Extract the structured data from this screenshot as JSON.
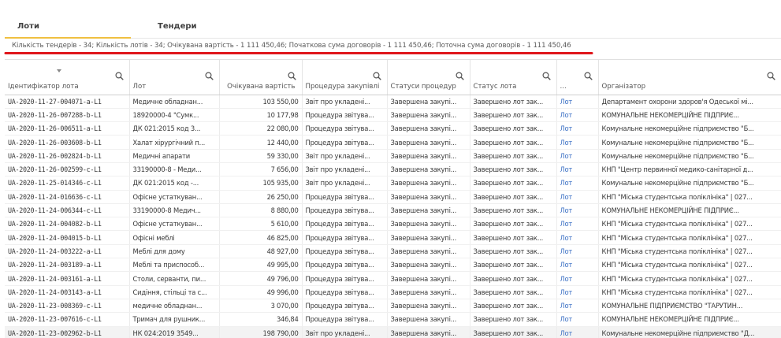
{
  "tabs": [
    {
      "label": "Лоти",
      "active": true
    },
    {
      "label": "Тендери",
      "active": false
    }
  ],
  "summary": "Кількість тендерів - 34; Кількість лотів - 34; Очікувана вартість - 1 111 450,46; Початкова сума договорів - 1 111 450,46; Поточна сума договорів - 1 111 450,46",
  "colors": {
    "accent_tab": "#f0c040",
    "underline": "#e0161b",
    "link": "#3a6fc4"
  },
  "columns": [
    {
      "label": "Ідентифікатор лота"
    },
    {
      "label": "Лот"
    },
    {
      "label": "Очікувана вартість"
    },
    {
      "label": "Процедура закупівлі"
    },
    {
      "label": "Статуси процедур"
    },
    {
      "label": "Статус лота"
    },
    {
      "label": "..."
    },
    {
      "label": "Організатор"
    }
  ],
  "rows": [
    [
      "UA-2020-11-27-004071-a-L1",
      "Медичне обладнан...",
      "103 550,00",
      "Звіт про укладені...",
      "Завершена закупі...",
      "Завершено лот зак...",
      "Лот",
      "Департамент охорони здоров'я Одеської мі..."
    ],
    [
      "UA-2020-11-26-007288-b-L1",
      "18920000-4 \"Сумк...",
      "10 177,98",
      "Процедура звітува...",
      "Завершена закупі...",
      "Завершено лот зак...",
      "Лот",
      "КОМУНАЛЬНЕ НЕКОМЕРЦІЙНЕ ПІДПРИЄ..."
    ],
    [
      "UA-2020-11-26-006511-a-L1",
      "ДК 021:2015 код 3...",
      "22 080,00",
      "Процедура звітува...",
      "Завершена закупі...",
      "Завершено лот зак...",
      "Лот",
      "Комунальне некомерційне підприємство \"Б..."
    ],
    [
      "UA-2020-11-26-003608-b-L1",
      "Халат хірургічний п...",
      "12 440,00",
      "Процедура звітува...",
      "Завершена закупі...",
      "Завершено лот зак...",
      "Лот",
      "Комунальне некомерційне підприємство \"Б..."
    ],
    [
      "UA-2020-11-26-002824-b-L1",
      "Медичні апарати",
      "59 330,00",
      "Звіт про укладені...",
      "Завершена закупі...",
      "Завершено лот зак...",
      "Лот",
      "Комунальне некомерційне підприємство \"Б..."
    ],
    [
      "UA-2020-11-26-002599-c-L1",
      "33190000-8 - Меди...",
      "7 656,00",
      "Звіт про укладені...",
      "Завершена закупі...",
      "Завершено лот зак...",
      "Лот",
      "КНП \"Центр первинної медико-санітарної д..."
    ],
    [
      "UA-2020-11-25-014346-c-L1",
      "ДК 021:2015 код -...",
      "105 935,00",
      "Звіт про укладені...",
      "Завершена закупі...",
      "Завершено лот зак...",
      "Лот",
      "Комунальне некомерційне підприємство \"Б..."
    ],
    [
      "UA-2020-11-24-016636-c-L1",
      "Офісне устаткуван...",
      "26 250,00",
      "Процедура звітува...",
      "Завершена закупі...",
      "Завершено лот зак...",
      "Лот",
      "КНП \"Міська студентська поліклініка\" | 027..."
    ],
    [
      "UA-2020-11-24-006344-c-L1",
      "33190000-8 Медич...",
      "8 880,00",
      "Процедура звітува...",
      "Завершена закупі...",
      "Завершено лот зак...",
      "Лот",
      "КОМУНАЛЬНЕ НЕКОМЕРЦІЙНЕ ПІДПРИЄ..."
    ],
    [
      "UA-2020-11-24-004082-b-L1",
      "Офісне устаткуван...",
      "5 610,00",
      "Процедура звітува...",
      "Завершена закупі...",
      "Завершено лот зак...",
      "Лот",
      "КНП \"Міська студентська поліклініка\" | 027..."
    ],
    [
      "UA-2020-11-24-004015-b-L1",
      "Офісні меблі",
      "46 825,00",
      "Процедура звітува...",
      "Завершена закупі...",
      "Завершено лот зак...",
      "Лот",
      "КНП \"Міська студентська поліклініка\" | 027..."
    ],
    [
      "UA-2020-11-24-003222-a-L1",
      "Меблі для дому",
      "48 927,00",
      "Процедура звітува...",
      "Завершена закупі...",
      "Завершено лот зак...",
      "Лот",
      "КНП \"Міська студентська поліклініка\" | 027..."
    ],
    [
      "UA-2020-11-24-003189-a-L1",
      "Меблі та приспособ...",
      "49 995,00",
      "Процедура звітува...",
      "Завершена закупі...",
      "Завершено лот зак...",
      "Лот",
      "КНП \"Міська студентська поліклініка\" | 027..."
    ],
    [
      "UA-2020-11-24-003161-a-L1",
      "Столи, серванти, пи...",
      "49 796,00",
      "Процедура звітува...",
      "Завершена закупі...",
      "Завершено лот зак...",
      "Лот",
      "КНП \"Міська студентська поліклініка\" | 027..."
    ],
    [
      "UA-2020-11-24-003143-a-L1",
      "Сидіння, стільці та с...",
      "49 996,00",
      "Процедура звітува...",
      "Завершена закупі...",
      "Завершено лот зак...",
      "Лот",
      "КНП \"Міська студентська поліклініка\" | 027..."
    ],
    [
      "UA-2020-11-23-008369-c-L1",
      "медичне обладнан...",
      "3 070,00",
      "Процедура звітува...",
      "Завершена закупі...",
      "Завершено лот зак...",
      "Лот",
      "КОМУНАЛЬНЕ ПІДПРИЄМСТВО \"ТАРУТИН..."
    ],
    [
      "UA-2020-11-23-007616-c-L1",
      "Тримач для рушник...",
      "346,84",
      "Процедура звітува...",
      "Завершена закупі...",
      "Завершено лот зак...",
      "Лот",
      "КОМУНАЛЬНЕ НЕКОМЕРЦІЙНЕ ПІДПРИЄ..."
    ],
    [
      "UA-2020-11-23-002962-b-L1",
      "НК 024:2019 3549...",
      "198 790,00",
      "Звіт про укладені...",
      "Завершена закупі...",
      "Завершено лот зак...",
      "Лот",
      "Комунальне некомерційне підприємство \"Д..."
    ]
  ]
}
